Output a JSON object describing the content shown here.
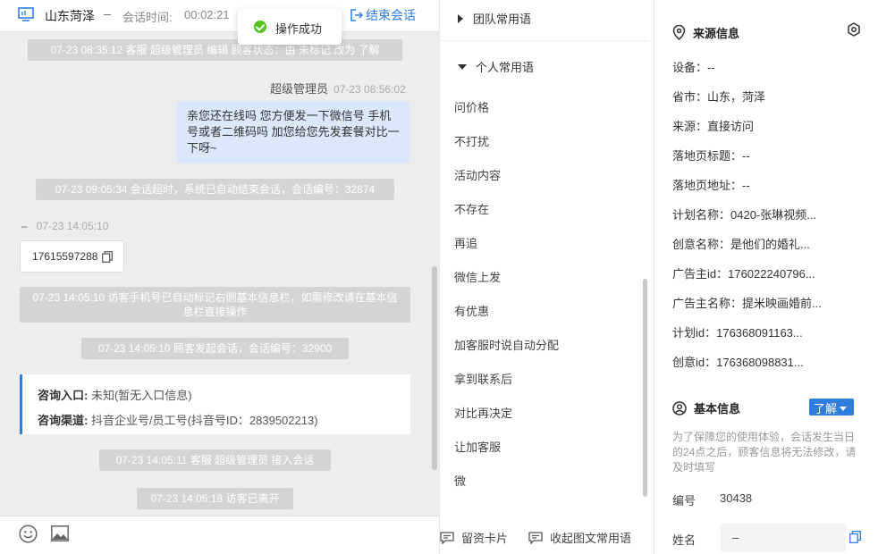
{
  "header": {
    "title": "山东菏泽",
    "separator": "–",
    "time_label": "会话时间:",
    "time_value": "00:02:21",
    "end_button": "结束会话"
  },
  "toast": {
    "text": "操作成功"
  },
  "messages": {
    "sys1": "07-23 08:35:12 客服 超级管理员 编辑 顾客状态：由 未标记 改为 了解",
    "sender_name": "超级管理员",
    "sender_time": "07-23 08:56:02",
    "agent_msg": "亲您还在线吗 您方便发一下微信号 手机号或者二维码吗 加您给您先发套餐对比一下呀~",
    "sys2": "07-23 09:05:34 会话超时，系统已自动结束会话，会话编号：32874",
    "visitor_dash": "–",
    "visitor_time": "07-23 14:05:10",
    "phone": "17615597288",
    "sys3": "07-23 14:05:10 访客手机号已自动标记右侧基本信息栏，如需修改请在基本信息栏直接操作",
    "sys4": "07-23 14:05:10 顾客发起会话，会话编号：32900",
    "entry_label": "咨询入口:",
    "entry_value": "未知(暂无入口信息)",
    "channel_label": "咨询渠道:",
    "channel_value": "抖音企业号/员工号(抖音号ID：2839502213)",
    "sys5": "07-23 14:05:11 客服 超级管理员 接入会话",
    "sys6": "07-23 14:05:18 访客已离开"
  },
  "phrases": {
    "team_title": "团队常用语",
    "personal_title": "个人常用语",
    "items": [
      "问价格",
      "不打扰",
      "活动内容",
      "不存在",
      "再追",
      "微信上发",
      "有优惠",
      "加客服时说自动分配",
      "拿到联系后",
      "对比再决定",
      "让加客服",
      "微"
    ],
    "card_button": "留资卡片",
    "collapse_button": "收起图文常用语"
  },
  "source": {
    "title": "来源信息",
    "rows": [
      "设备：--",
      "省市：山东，菏泽",
      "来源：直接访问",
      "落地页标题：--",
      "落地页地址：--",
      "计划名称：0420-张琳视频...",
      "创意名称：是他们的婚礼...",
      "广告主id：176022240796...",
      "广告主名称：提米映画婚前...",
      "计划id：176368091163...",
      "创意id：176368098831..."
    ]
  },
  "basic": {
    "title": "基本信息",
    "status_tag": "了解",
    "note": "为了保障您的使用体验，会话发生当日的24点之后，顾客信息将无法修改，请及时填写",
    "id_label": "编号",
    "id_value": "30438",
    "name_label": "姓名",
    "name_value": "–"
  },
  "colors": {
    "accent": "#2f7de1",
    "system_bg": "#d4d4d4",
    "bubble": "#dbe8fb",
    "success": "#52c41a"
  }
}
